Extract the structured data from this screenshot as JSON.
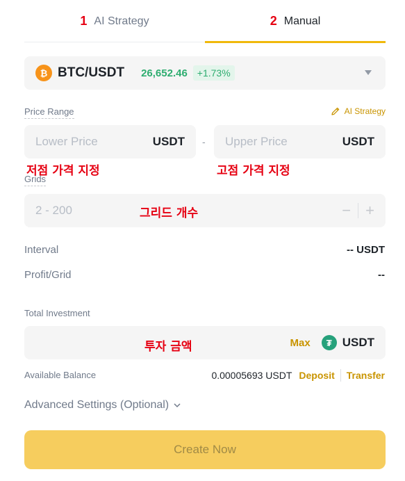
{
  "tabs": [
    {
      "num": "1",
      "label": "AI Strategy"
    },
    {
      "num": "2",
      "label": "Manual"
    }
  ],
  "pair": {
    "coin_icon": "bitcoin-icon",
    "coin_glyph": "₿",
    "symbol": "BTC/USDT",
    "price": "26,652.46",
    "change": "+1.73%"
  },
  "price_range": {
    "label": "Price Range",
    "ai_link": "AI Strategy",
    "lower_placeholder": "Lower Price",
    "lower_unit": "USDT",
    "separator": "-",
    "upper_placeholder": "Upper Price",
    "upper_unit": "USDT",
    "lower_annotation": "저점 가격 지정",
    "upper_annotation": "고점 가격 지정"
  },
  "grids": {
    "label": "Grids",
    "placeholder": "2 - 200",
    "annotation": "그리드 개수",
    "minus": "−",
    "plus": "+"
  },
  "interval": {
    "label": "Interval",
    "value": "-- USDT"
  },
  "profit_grid": {
    "label": "Profit/Grid",
    "value": "--"
  },
  "investment": {
    "label": "Total Investment",
    "annotation": "투자 금액",
    "max_label": "Max",
    "tether_glyph": "₮",
    "unit": "USDT"
  },
  "balance": {
    "label": "Available Balance",
    "value": "0.00005693 USDT",
    "deposit": "Deposit",
    "transfer": "Transfer"
  },
  "advanced": {
    "label": "Advanced Settings (Optional)"
  },
  "create_button": {
    "label": "Create Now"
  },
  "colors": {
    "accent": "#f0b90b",
    "positive": "#2ead70",
    "annotation": "#e60012",
    "link": "#c99400"
  }
}
